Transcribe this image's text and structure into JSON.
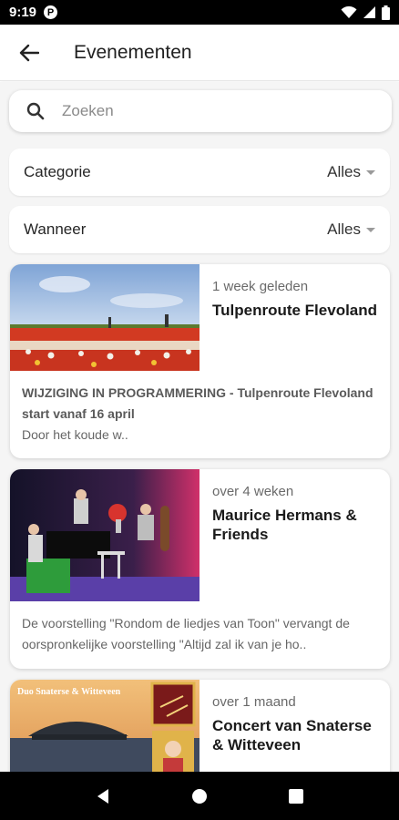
{
  "status_bar": {
    "time": "9:19",
    "app_badge": "P"
  },
  "app_bar": {
    "title": "Evenementen"
  },
  "search": {
    "placeholder": "Zoeken"
  },
  "filters": [
    {
      "label": "Categorie",
      "value": "Alles"
    },
    {
      "label": "Wanneer",
      "value": "Alles"
    }
  ],
  "events": [
    {
      "time_ago": "1 week geleden",
      "title": "Tulpenroute Flevoland",
      "description_bold": "WIJZIGING IN PROGRAMMERING - Tulpenroute Flevoland start vanaf 16 april",
      "description": "Door het koude w.."
    },
    {
      "time_ago": "over 4 weken",
      "title": "Maurice Hermans & Friends",
      "description_bold": "",
      "description": "De voorstelling \"Rondom de liedjes van Toon\" vervangt de oorspronkelijke voorstelling \"Altijd zal ik van je ho.."
    },
    {
      "time_ago": "over 1 maand",
      "title": "Concert van Snaterse & Witteveen",
      "poster_text": "Duo Snaterse & Witteveen"
    }
  ],
  "colors": {
    "status_bar": "#000000",
    "background": "#f5f5f5",
    "card": "#ffffff"
  }
}
